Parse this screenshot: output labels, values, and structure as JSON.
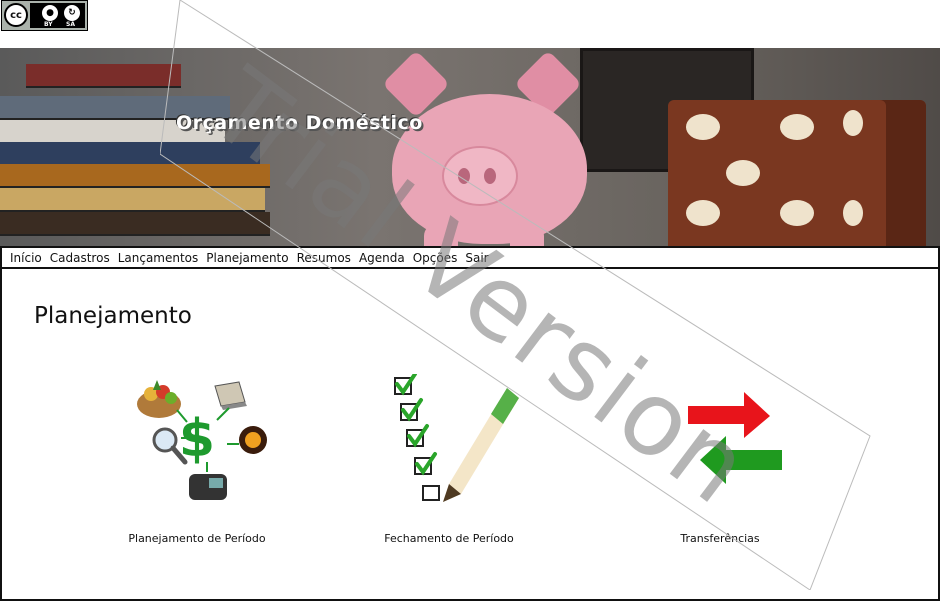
{
  "license_badge": {
    "cc": "cc",
    "by": "BY",
    "sa": "SA"
  },
  "banner": {
    "title": "Orçamento Doméstico"
  },
  "menu": [
    {
      "label": "Início"
    },
    {
      "label": "Cadastros"
    },
    {
      "label": "Lançamentos"
    },
    {
      "label": "Planejamento"
    },
    {
      "label": "Resumos"
    },
    {
      "label": "Agenda"
    },
    {
      "label": "Opções"
    },
    {
      "label": "Sair"
    }
  ],
  "page": {
    "title": "Planejamento"
  },
  "tiles": [
    {
      "label": "Planejamento de Período",
      "icon": "budget-planning-icon"
    },
    {
      "label": "Fechamento de Período",
      "icon": "checklist-pencil-icon"
    },
    {
      "label": "Transferências",
      "icon": "transfer-arrows-icon"
    }
  ],
  "watermark": {
    "text": "Trial Version"
  },
  "colors": {
    "menu_border": "#111111",
    "pig_pink": "#e9a5b6",
    "arrow_red": "#e8141b",
    "arrow_green": "#1f9a1f"
  }
}
